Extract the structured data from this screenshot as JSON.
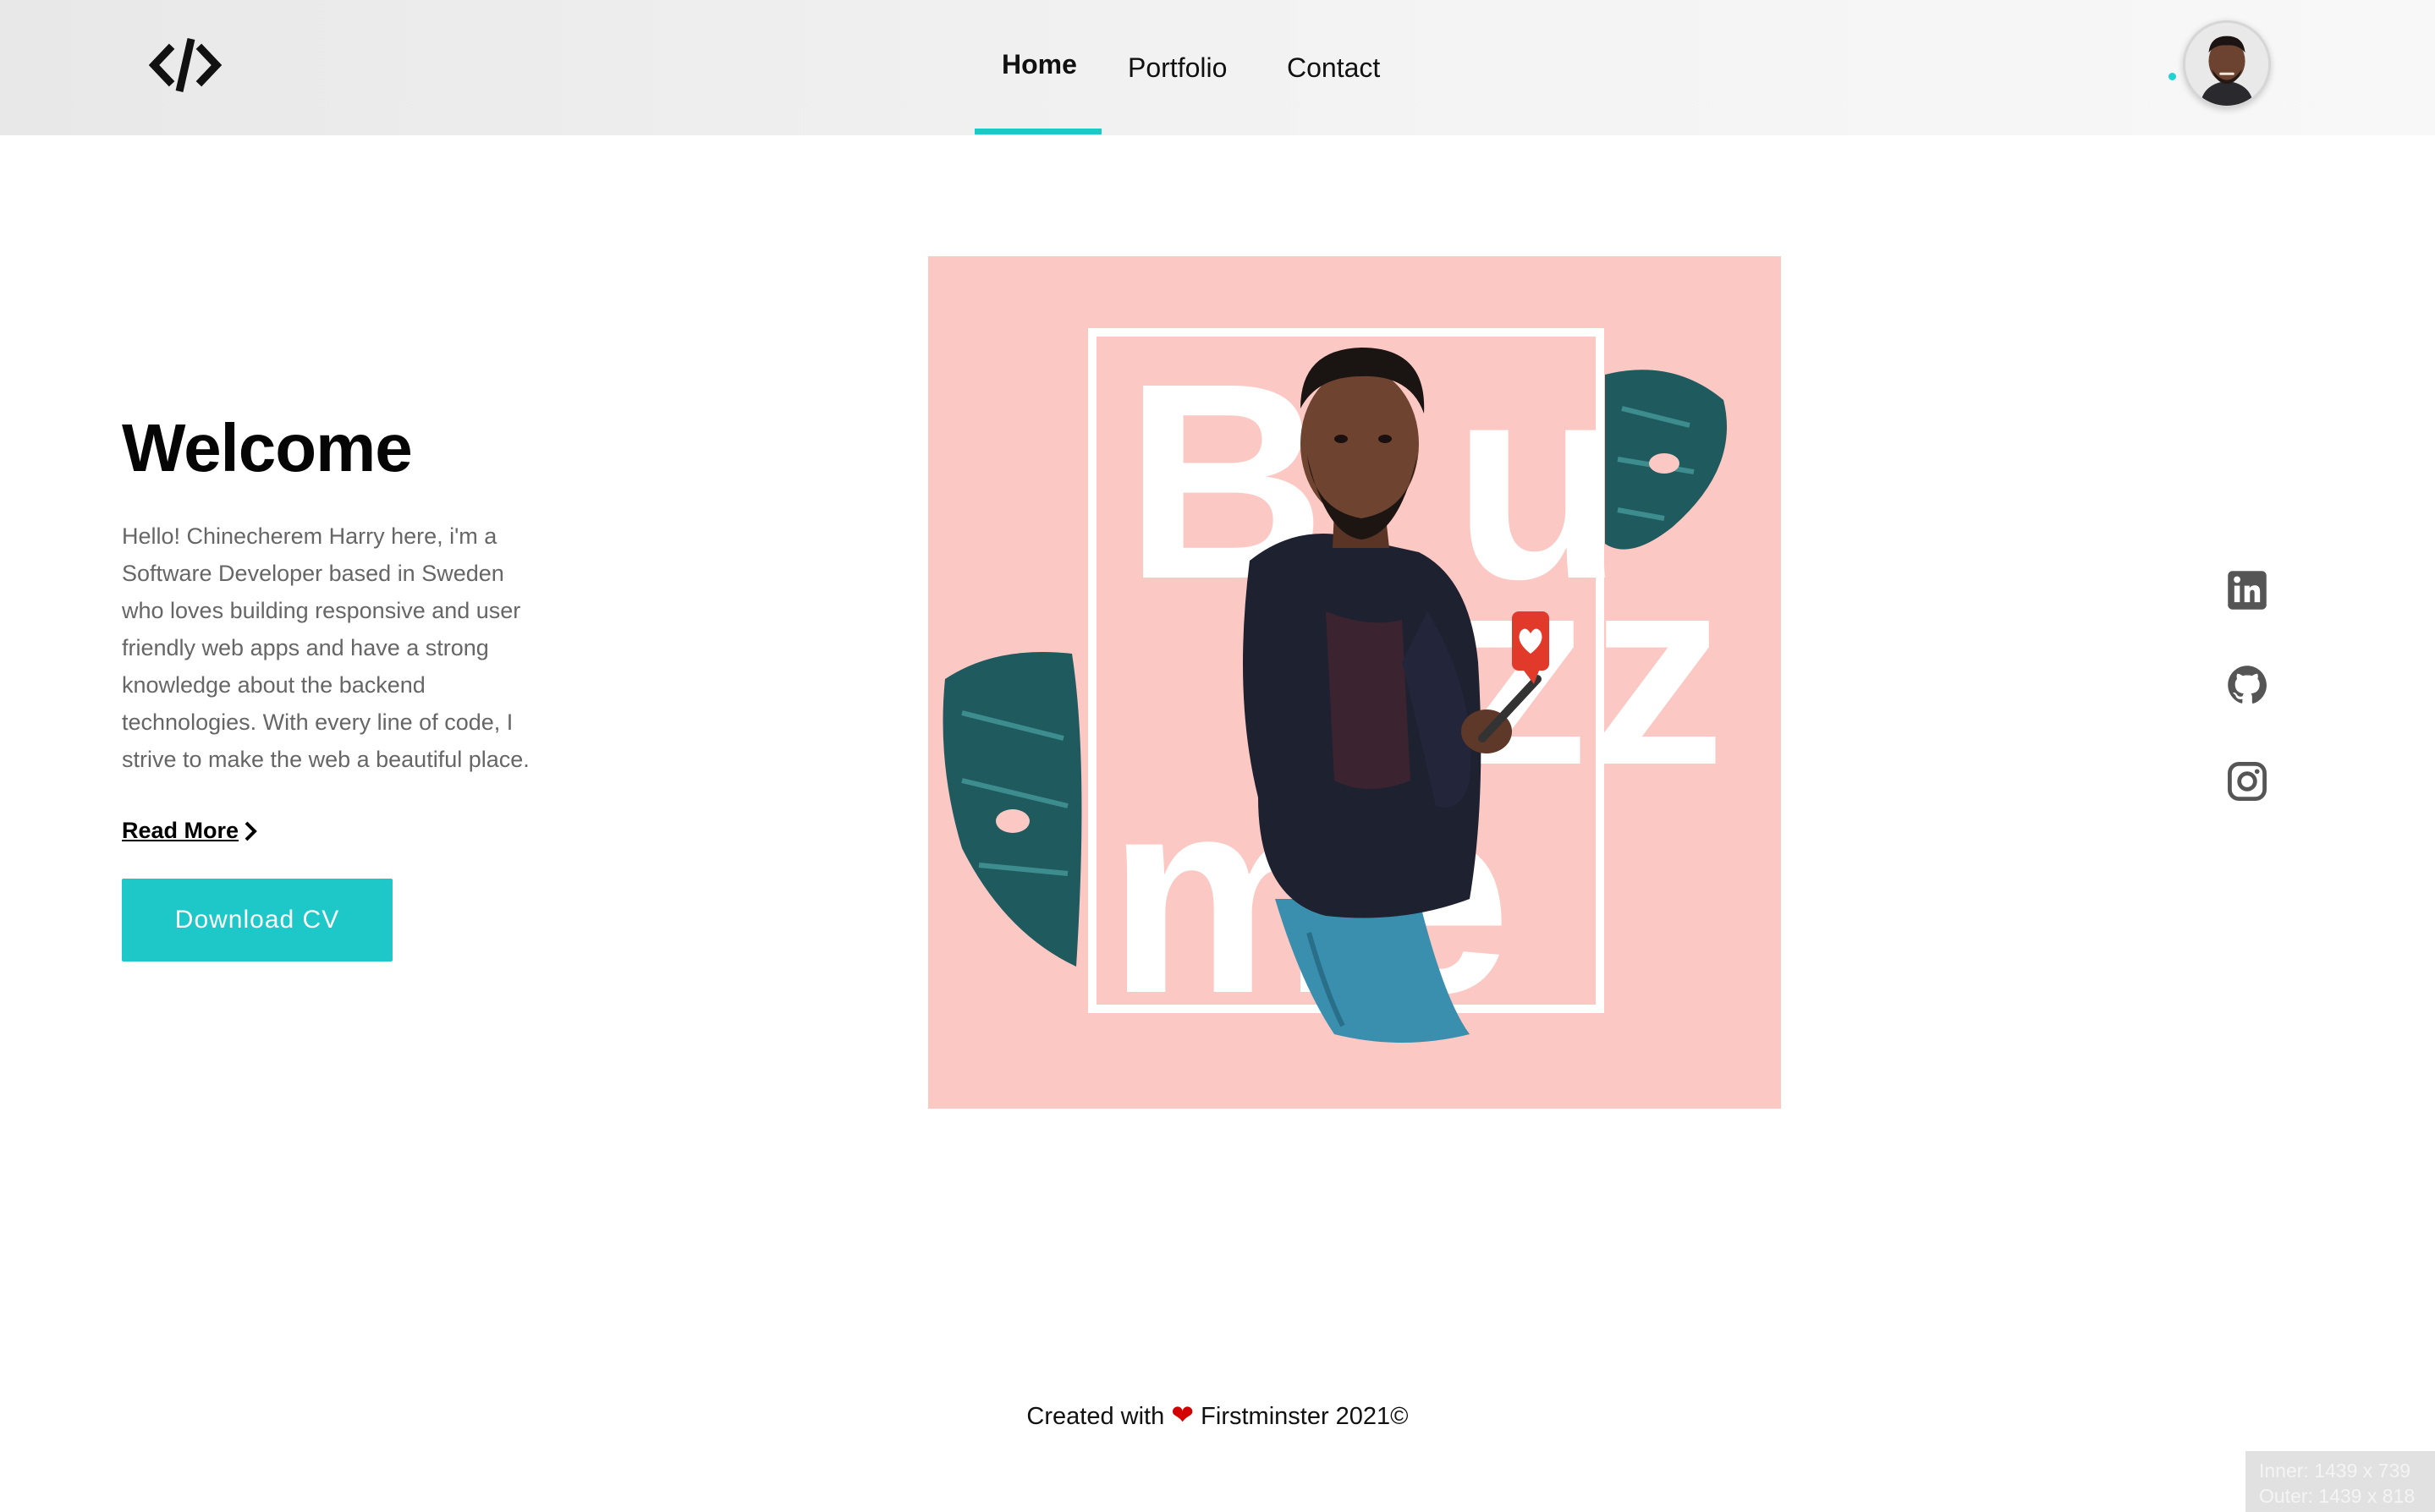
{
  "header": {
    "nav": [
      {
        "label": "Home",
        "active": true
      },
      {
        "label": "Portfolio",
        "active": false
      },
      {
        "label": "Contact",
        "active": false
      }
    ],
    "accent_color": "#1ec8c8"
  },
  "hero": {
    "title": "Welcome",
    "intro": "Hello! Chinecherem Harry here, i'm a Software Developer based in Sweden who loves building responsive and user friendly web apps and have a strong knowledge about the backend technologies. With every line of code, I strive to make the web a beautiful place.",
    "read_more": "Read More",
    "download_cv": "Download CV"
  },
  "artwork": {
    "word_top_left": "B",
    "word_top_right": "u",
    "word_mid": "zz",
    "word_bottom": "me",
    "background_color": "#fcc8c4"
  },
  "social": [
    {
      "icon": "linkedin-icon"
    },
    {
      "icon": "github-icon"
    },
    {
      "icon": "instagram-icon"
    }
  ],
  "footer": {
    "prefix": "Created with",
    "suffix": "Firstminster 2021©"
  },
  "devtools": {
    "inner": "Inner: 1439 x 739",
    "outer": "Outer: 1439 x 818"
  }
}
